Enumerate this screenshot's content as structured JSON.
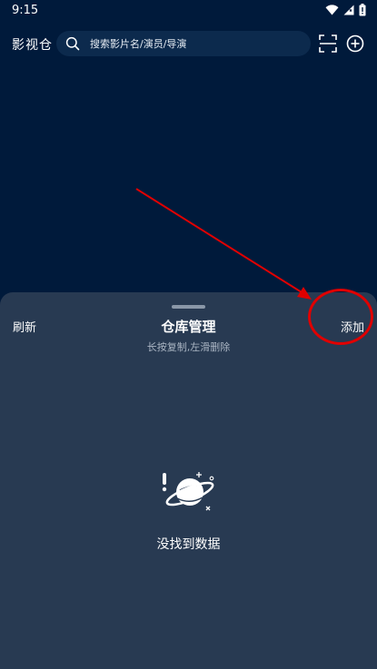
{
  "status_bar": {
    "time": "9:15",
    "icons": [
      "wifi-icon",
      "signal-icon",
      "battery-icon"
    ]
  },
  "header": {
    "title": "影视仓",
    "search": {
      "placeholder": "搜索影片名/演员/导演",
      "icon": "search-icon"
    },
    "actions": [
      "scan-icon",
      "add-circle-icon"
    ]
  },
  "sheet": {
    "refresh_label": "刷新",
    "title": "仓库管理",
    "subtitle": "长按复制,左滑删除",
    "add_label": "添加",
    "empty_icon": "planet-icon",
    "empty_text": "没找到数据"
  },
  "colors": {
    "background": "#001a3b",
    "search_bg": "#0c2a4d",
    "sheet_bg": "#283a52",
    "annotation": "#e00000",
    "subtitle": "#aab5c3"
  }
}
